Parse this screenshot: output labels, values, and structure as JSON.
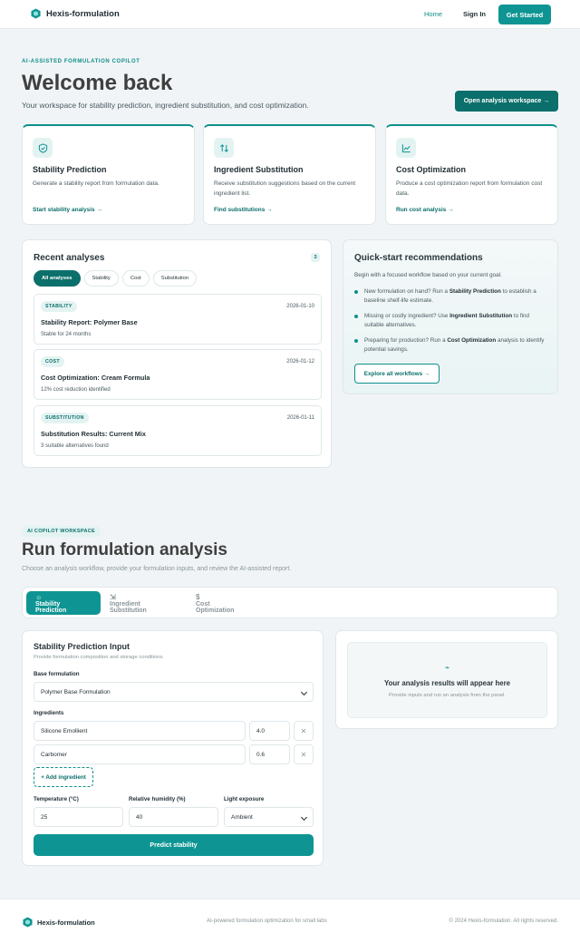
{
  "nav": {
    "brand": "Hexis-formulation",
    "home": "Home",
    "sign_in": "Sign In",
    "cta": "Get Started"
  },
  "hero": {
    "eyebrow": "AI-ASSISTED FORMULATION COPILOT",
    "title": "Welcome back",
    "subtitle": "Your workspace for stability prediction, ingredient substitution, and cost optimization.",
    "cta": "Open analysis workspace →"
  },
  "cards": [
    {
      "icon": "shield-icon",
      "title": "Stability Prediction",
      "desc": "Generate a stability report from formulation data.",
      "link": "Start stability analysis →"
    },
    {
      "icon": "swap-arrows-icon",
      "title": "Ingredient Substitution",
      "desc": "Receive substitution suggestions based on the current ingredient list.",
      "link": "Find substitutions →"
    },
    {
      "icon": "line-chart-icon",
      "title": "Cost Optimization",
      "desc": "Produce a cost optimization report from formulation cost data.",
      "link": "Run cost analysis →"
    }
  ],
  "recent": {
    "title": "Recent analyses",
    "count": "3",
    "filters": [
      "All analyses",
      "Stability",
      "Cost",
      "Substitution"
    ],
    "active_filter": "All analyses",
    "items": [
      {
        "badge": "STABILITY",
        "date": "2026-01-10",
        "title": "Stability Report: Polymer Base",
        "sub": "Stable for 24 months"
      },
      {
        "badge": "COST",
        "date": "2026-01-12",
        "title": "Cost Optimization: Cream Formula",
        "sub": "12% cost reduction identified"
      },
      {
        "badge": "SUBSTITUTION",
        "date": "2026-01-11",
        "title": "Substitution Results: Current Mix",
        "sub": "3 suitable alternatives found"
      }
    ]
  },
  "quick": {
    "title": "Quick-start recommendations",
    "intro": "Begin with a focused workflow based on your current goal.",
    "items": [
      {
        "pre": "New formulation on hand? Run a ",
        "bold": "Stability Prediction",
        "post": " to establish a baseline shelf-life estimate."
      },
      {
        "pre": "Missing or costly ingredient? Use ",
        "bold": "Ingredient Substitution",
        "post": " to find suitable alternatives."
      },
      {
        "pre": "Preparing for production? Run a ",
        "bold": "Cost Optimization",
        "post": " analysis to identify potential savings."
      }
    ],
    "button": "Explore all workflows →"
  },
  "workspace": {
    "tag": "AI COPILOT WORKSPACE",
    "title": "Run formulation analysis",
    "subtitle": "Choose an analysis workflow, provide your formulation inputs, and review the AI-assisted report.",
    "tabs": [
      {
        "icon": "☼",
        "label": "Stability Prediction"
      },
      {
        "icon": "⇲",
        "label": "Ingredient Substitution"
      },
      {
        "icon": "$",
        "label": "Cost Optimization"
      }
    ],
    "active_tab": "Stability Prediction"
  },
  "form": {
    "title": "Stability Prediction Input",
    "hint": "Provide formulation composition and storage conditions.",
    "base_label": "Base formulation",
    "base_value": "Polymer Base Formulation",
    "ingredients_label": "Ingredients",
    "ingredients": [
      {
        "name": "Silicone Emollient",
        "qty": "4.0"
      },
      {
        "name": "Carbomer",
        "qty": "0.6"
      }
    ],
    "add_label": "+ Add ingredient",
    "temp_label": "Temperature (°C)",
    "temp_value": "25",
    "humidity_label": "Relative humidity (%)",
    "humidity_value": "40",
    "light_label": "Light exposure",
    "light_value": "Ambient",
    "submit": "Predict stability"
  },
  "results": {
    "icon": "⌁",
    "title": "Your analysis results will appear here",
    "subtitle": "Provide inputs and run an analysis from the panel."
  },
  "footer": {
    "brand": "Hexis-formulation",
    "tagline": "AI-powered formulation optimization for small labs",
    "copyright": "© 2024 Hexis-formulation. All rights reserved."
  },
  "colors": {
    "accent": "#0e9593",
    "accent_dark": "#0b6f6b",
    "background": "#f0f4f6"
  }
}
